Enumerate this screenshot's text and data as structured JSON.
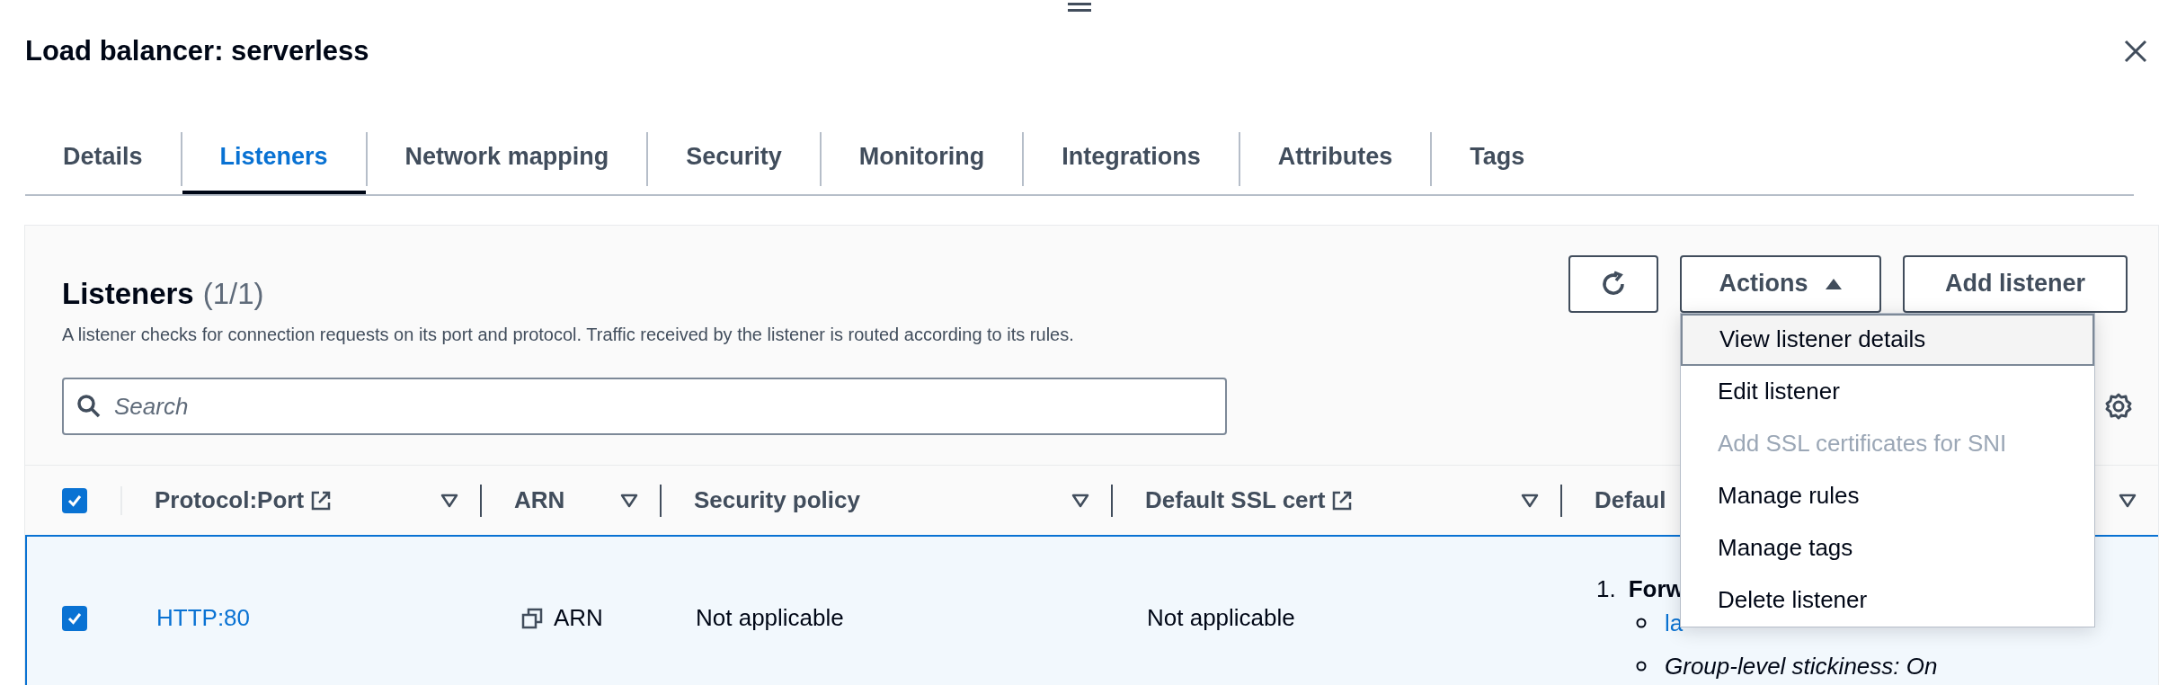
{
  "title": "Load balancer: serverless",
  "tabs": [
    {
      "label": "Details",
      "selected": false
    },
    {
      "label": "Listeners",
      "selected": true
    },
    {
      "label": "Network mapping",
      "selected": false
    },
    {
      "label": "Security",
      "selected": false
    },
    {
      "label": "Monitoring",
      "selected": false
    },
    {
      "label": "Integrations",
      "selected": false
    },
    {
      "label": "Attributes",
      "selected": false
    },
    {
      "label": "Tags",
      "selected": false
    }
  ],
  "panel": {
    "heading": "Listeners",
    "count": "(1/1)",
    "description": "A listener checks for connection requests on its port and protocol. Traffic received by the listener is routed according to its rules.",
    "search": {
      "placeholder": "Search"
    },
    "actions_label": "Actions",
    "add_label": "Add listener",
    "menu": {
      "expanded": true,
      "items": [
        {
          "label": "View listener details",
          "highlighted": true,
          "disabled": false
        },
        {
          "label": "Edit listener",
          "highlighted": false,
          "disabled": false
        },
        {
          "label": "Add SSL certificates for SNI",
          "highlighted": false,
          "disabled": true
        },
        {
          "label": "Manage rules",
          "highlighted": false,
          "disabled": false
        },
        {
          "label": "Manage tags",
          "highlighted": false,
          "disabled": false
        },
        {
          "label": "Delete listener",
          "highlighted": false,
          "disabled": false
        }
      ]
    }
  },
  "table": {
    "all_selected": true,
    "columns": [
      {
        "label": "Protocol:Port",
        "external": true
      },
      {
        "label": "ARN",
        "external": false
      },
      {
        "label": "Security policy",
        "external": false
      },
      {
        "label": "Default SSL cert",
        "external": true
      },
      {
        "label": "Defaul",
        "external": false
      }
    ],
    "rows": [
      {
        "selected": true,
        "protocol_port": "HTTP:80",
        "arn": "ARN",
        "security_policy": "Not applicable",
        "default_ssl_cert": "Not applicable",
        "action_number": "1.",
        "action": "Forw",
        "details": [
          {
            "kind": "link",
            "text": "la"
          },
          {
            "kind": "italic",
            "text": "Group-level stickiness: On"
          }
        ]
      }
    ]
  }
}
